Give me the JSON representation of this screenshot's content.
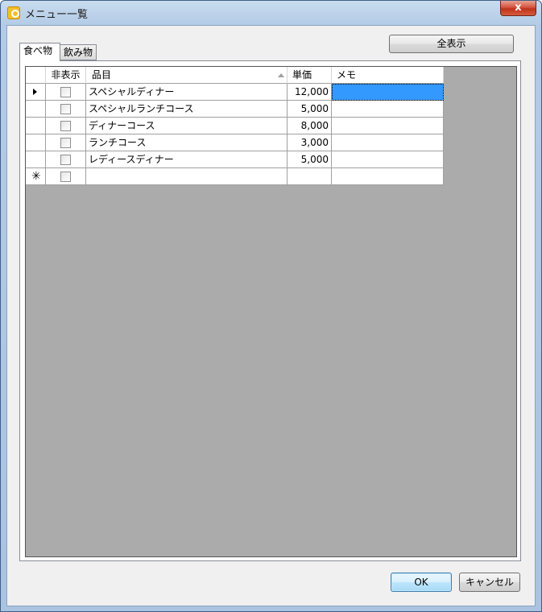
{
  "window": {
    "title": "メニュー一覧",
    "close_glyph": "x",
    "icon": "app-icon"
  },
  "toolbar": {
    "show_all_label": "全表示"
  },
  "tabs": [
    {
      "label": "食べ物",
      "selected": true
    },
    {
      "label": "飲み物",
      "selected": false
    }
  ],
  "grid": {
    "columns": [
      "非表示",
      "品目",
      "単価",
      "メモ"
    ],
    "sort_column": "品目",
    "sort_direction": "ascending",
    "rows": [
      {
        "hidden": false,
        "item": "スペシャルディナー",
        "price": "12,000",
        "memo": "",
        "current": true
      },
      {
        "hidden": false,
        "item": "スペシャルランチコース",
        "price": "5,000",
        "memo": ""
      },
      {
        "hidden": false,
        "item": "ディナーコース",
        "price": "8,000",
        "memo": ""
      },
      {
        "hidden": false,
        "item": "ランチコース",
        "price": "3,000",
        "memo": ""
      },
      {
        "hidden": false,
        "item": "レディースディナー",
        "price": "5,000",
        "memo": ""
      }
    ],
    "new_row_glyph": "✳",
    "selection_color": "#3399ff",
    "background_color": "#ababab"
  },
  "buttons": {
    "ok_label": "OK",
    "cancel_label": "キャンセル"
  }
}
